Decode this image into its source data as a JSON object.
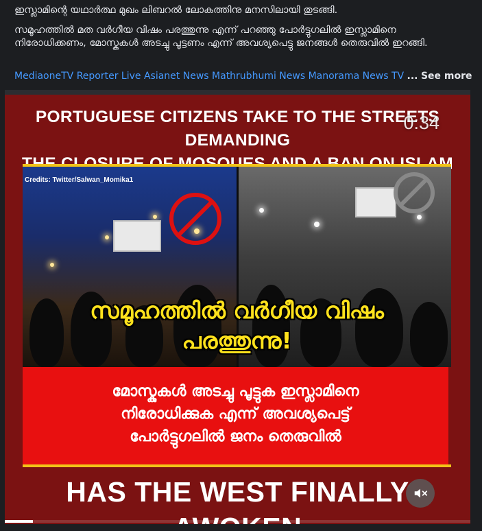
{
  "post": {
    "line1": "ഇസ്ലാമിന്റെ യഥാർത്ഥ മുഖം ലിബറൽ ലോകത്തിനു മനസിലായി തുടങ്ങി.",
    "line2": "സമൂഹത്തിൽ മത വർഗീയ വിഷം പരത്തുന്നു എന്ന് പറഞ്ഞു പോർട്ടുഗലിൽ ഇസ്ലാമിനെ നിരോധിക്കണം, മോസ്കുകൾ അടച്ചു പൂട്ടണം എന്ന് അവശ്യപെട്ടു ജനങ്ങൾ തെരുവിൽ ഇറങ്ങി.",
    "tags": [
      "MediaoneTV",
      "Reporter Live",
      "Asianet News",
      "Mathrubhumi News",
      "Manorama News TV"
    ],
    "ellipsis": "...",
    "see_more": "See more"
  },
  "video": {
    "headline_line1": "PORTUGUESE CITIZENS TAKE TO THE STREETS DEMANDING",
    "headline_line2": "THE CLOSURE OF MOSQUES AND A BAN ON ISLAM",
    "timer": "0:34",
    "credits": "Credits: Twitter/Salwan_Momika1",
    "overlay_line1": "സമൂഹത്തിൽ വർഗീയ വിഷം",
    "overlay_line2": "പരത്തുന്നു!",
    "red_box_line1": "മോസ്കുകൾ അടച്ചു പൂട്ടുക ഇസ്ലാമിനെ",
    "red_box_line2": "നിരോധിക്കുക എന്ന് അവശ്യപെട്ട്",
    "red_box_line3": "പോർട്ടുഗലിൽ ജനം തെരുവിൽ",
    "bottom_headline": "HAS THE WEST FINALLY AWOKEN",
    "progress_fraction": 0.06,
    "mute_icon": "muted-speaker-icon"
  },
  "colors": {
    "background": "#1c1e21",
    "link": "#4599ff",
    "media_bg": "#7b1212",
    "red_box": "#e81010",
    "overlay_yellow": "#ffe21c",
    "accent_yellow": "#f2c318"
  }
}
